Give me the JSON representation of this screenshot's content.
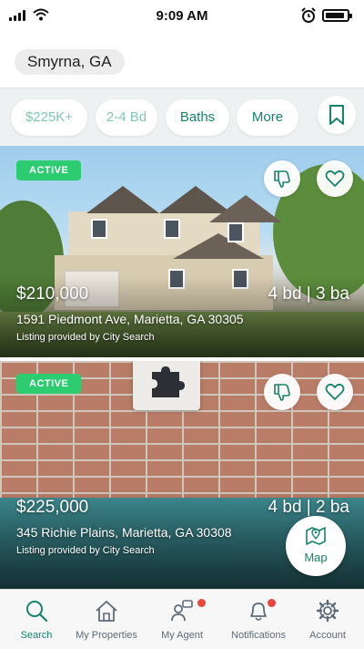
{
  "status_bar": {
    "time": "9:09 AM",
    "icons": [
      "signal-icon",
      "wifi-icon",
      "alarm-icon",
      "battery-icon"
    ]
  },
  "location": {
    "label": "Smyrna, GA"
  },
  "filters": {
    "price": "$225K+",
    "beds": "2-4 Bd",
    "baths": "Baths",
    "more": "More",
    "save_icon": "bookmark-icon"
  },
  "listings": [
    {
      "status": "ACTIVE",
      "price": "$210,000",
      "beds_baths": "4 bd | 3 ba",
      "address": "1591 Piedmont Ave, Marietta, GA 30305",
      "provider": "Listing provided by City Search",
      "icons": [
        "thumbs-down-icon",
        "heart-icon"
      ]
    },
    {
      "status": "ACTIVE",
      "price": "$225,000",
      "beds_baths": "4 bd | 2 ba",
      "address": "345 Richie Plains, Marietta, GA 30308",
      "provider": "Listing provided by City Search",
      "icons": [
        "thumbs-down-icon",
        "heart-icon",
        "puzzle-icon"
      ]
    }
  ],
  "map_button": {
    "label": "Map",
    "icon": "map-pin-icon"
  },
  "nav": {
    "items": [
      {
        "label": "Search",
        "icon": "search-icon",
        "active": true
      },
      {
        "label": "My Properties",
        "icon": "home-icon"
      },
      {
        "label": "My Agent",
        "icon": "agent-icon",
        "badge": true
      },
      {
        "label": "Notifications",
        "icon": "bell-icon",
        "badge": true
      },
      {
        "label": "Account",
        "icon": "gear-icon"
      }
    ]
  },
  "colors": {
    "brand": "#17846a",
    "active_badge": "#2ecc71",
    "notification_dot": "#e8453c"
  }
}
